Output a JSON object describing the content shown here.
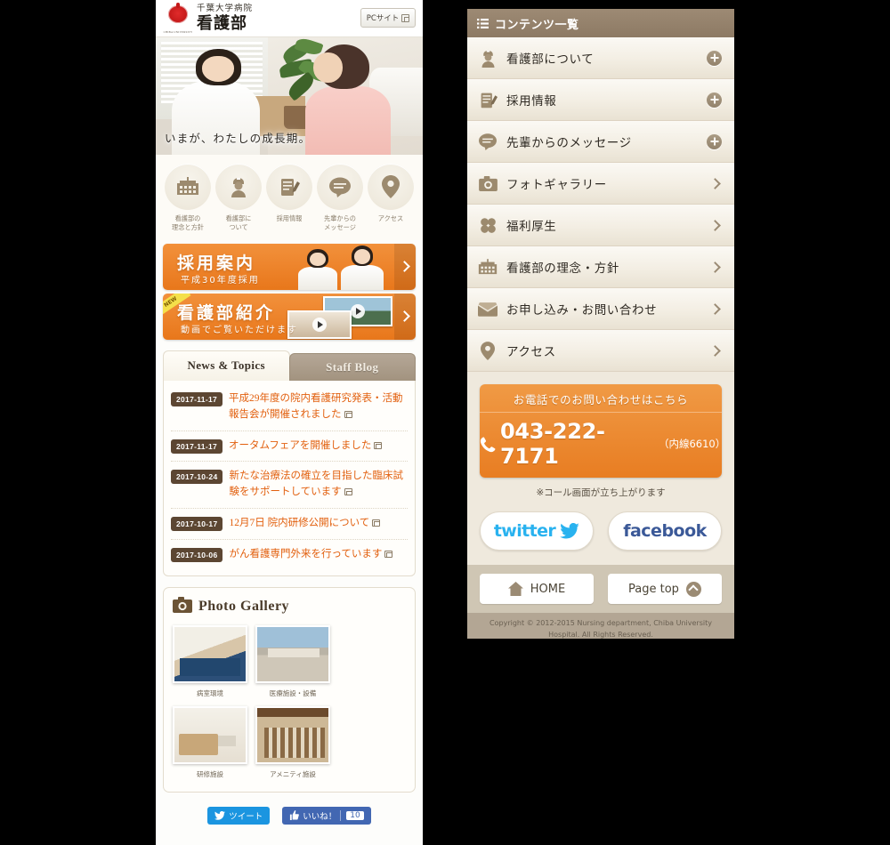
{
  "header": {
    "university_mark": "CHIBA UNIVERSITY",
    "hospital": "千葉大学病院",
    "department": "看護部",
    "pc_site_label": "PCサイト",
    "pc_site_icon": "external-window-icon"
  },
  "hero": {
    "catchcopy": "いまが、わたしの成長期。"
  },
  "circle_nav": [
    {
      "icon": "hospital-building-icon",
      "label": "看護部の\n理念と方針"
    },
    {
      "icon": "nurse-person-icon",
      "label": "看護部に\nついて"
    },
    {
      "icon": "clipboard-pen-icon",
      "label": "採用情報"
    },
    {
      "icon": "speech-bubble-icon",
      "label": "先輩からの\nメッセージ"
    },
    {
      "icon": "map-pin-icon",
      "label": "アクセス"
    }
  ],
  "banners": [
    {
      "title": "採用案内",
      "subtitle": "平成30年度採用",
      "badge": "",
      "arrow": "chevron-right-icon"
    },
    {
      "title": "看護部紹介",
      "subtitle": "動画でご覧いただけます",
      "badge": "NEW",
      "arrow": "chevron-right-icon"
    }
  ],
  "news": {
    "tabs": [
      {
        "label": "News & Topics",
        "active": true
      },
      {
        "label": "Staff Blog",
        "active": false
      }
    ],
    "items": [
      {
        "date": "2017-11-17",
        "title": "平成29年度の院内看護研究発表・活動報告会が開催されました"
      },
      {
        "date": "2017-11-17",
        "title": "オータムフェアを開催しました"
      },
      {
        "date": "2017-10-24",
        "title": "新たな治療法の確立を目指した臨床試験をサポートしています"
      },
      {
        "date": "2017-10-17",
        "title": "12月7日 院内研修公開について"
      },
      {
        "date": "2017-10-06",
        "title": "がん看護専門外来を行っています"
      }
    ]
  },
  "gallery": {
    "icon": "camera-icon",
    "title": "Photo Gallery",
    "items": [
      {
        "caption": "病室環境"
      },
      {
        "caption": "医療施設・設備"
      },
      {
        "caption": "研修施設"
      },
      {
        "caption": "アメニティ施設"
      }
    ]
  },
  "social_bottom": {
    "tweet_label": "ツイート",
    "tweet_icon": "twitter-bird-icon",
    "like_label": "いいね！",
    "like_icon": "thumbs-up-icon",
    "like_count": "10"
  },
  "menu": {
    "icon": "list-icon",
    "header_title": "コンテンツ一覧",
    "items": [
      {
        "icon": "nurse-person-icon",
        "label": "看護部について",
        "marker": "plus"
      },
      {
        "icon": "clipboard-pen-icon",
        "label": "採用情報",
        "marker": "plus"
      },
      {
        "icon": "speech-bubble-icon",
        "label": "先輩からのメッセージ",
        "marker": "plus"
      },
      {
        "icon": "camera-icon",
        "label": "フォトギャラリー",
        "marker": "chevron"
      },
      {
        "icon": "clover-icon",
        "label": "福利厚生",
        "marker": "chevron"
      },
      {
        "icon": "hospital-building-icon",
        "label": "看護部の理念・方針",
        "marker": "chevron"
      },
      {
        "icon": "envelope-icon",
        "label": "お申し込み・お問い合わせ",
        "marker": "chevron"
      },
      {
        "icon": "map-pin-icon",
        "label": "アクセス",
        "marker": "chevron"
      }
    ]
  },
  "contact": {
    "heading": "お電話でのお問い合わせはこちら",
    "phone_icon": "phone-handset-icon",
    "number": "043-222-7171",
    "extension": "（内線6610）",
    "note": "※コール画面が立ち上がります"
  },
  "sns": {
    "twitter_label": "twitter",
    "twitter_icon": "twitter-bird-icon",
    "facebook_label": "facebook"
  },
  "footer": {
    "home_label": "HOME",
    "home_icon": "home-icon",
    "pagetop_label": "Page top",
    "pagetop_icon": "chevron-up-icon",
    "copyright": "Copyright © 2012-2015 Nursing department, Chiba University Hospital. All Rights Reserved."
  },
  "colors": {
    "orange": "#e8771b",
    "brown": "#8d7a64",
    "dark_brown": "#5c4632",
    "cream": "#efe9dd",
    "news_link": "#e2600f",
    "twitter_blue": "#1b95e0",
    "facebook_blue": "#4267b2"
  }
}
